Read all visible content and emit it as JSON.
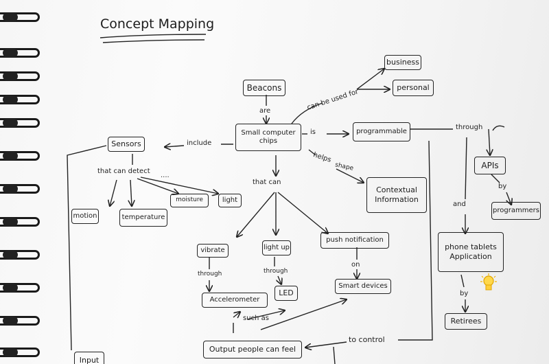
{
  "title": "Concept Mapping",
  "nodes": {
    "beacons": "Beacons",
    "chips": "Small computer chips",
    "sensors": "Sensors",
    "programmable": "programmable",
    "business": "business",
    "personal": "personal",
    "contextual": "Contextual Information",
    "apis": "APIs",
    "programmers": "programmers",
    "phone": "phone tablets Application",
    "retirees": "Retirees",
    "motion": "motion",
    "temperature": "temperature",
    "moisture": "moisture",
    "light": "light",
    "vibrate": "vibrate",
    "lightup": "light up",
    "push": "push notification",
    "accelerometer": "Accelerometer",
    "led": "LED",
    "smart": "Smart devices",
    "output": "Output people can feel",
    "input": "Input"
  },
  "labels": {
    "are": "are",
    "canbe": "can be used for",
    "is": "is",
    "include": "include",
    "helps": "helps",
    "shape": "shape",
    "through1": "through",
    "by1": "by",
    "and": "and",
    "by2": "by",
    "thatcan": "that can",
    "detect": "that can detect",
    "dots": "....",
    "through2": "through",
    "through3": "through",
    "on": "on",
    "suchas": "such as",
    "tocontrol": "to control"
  }
}
